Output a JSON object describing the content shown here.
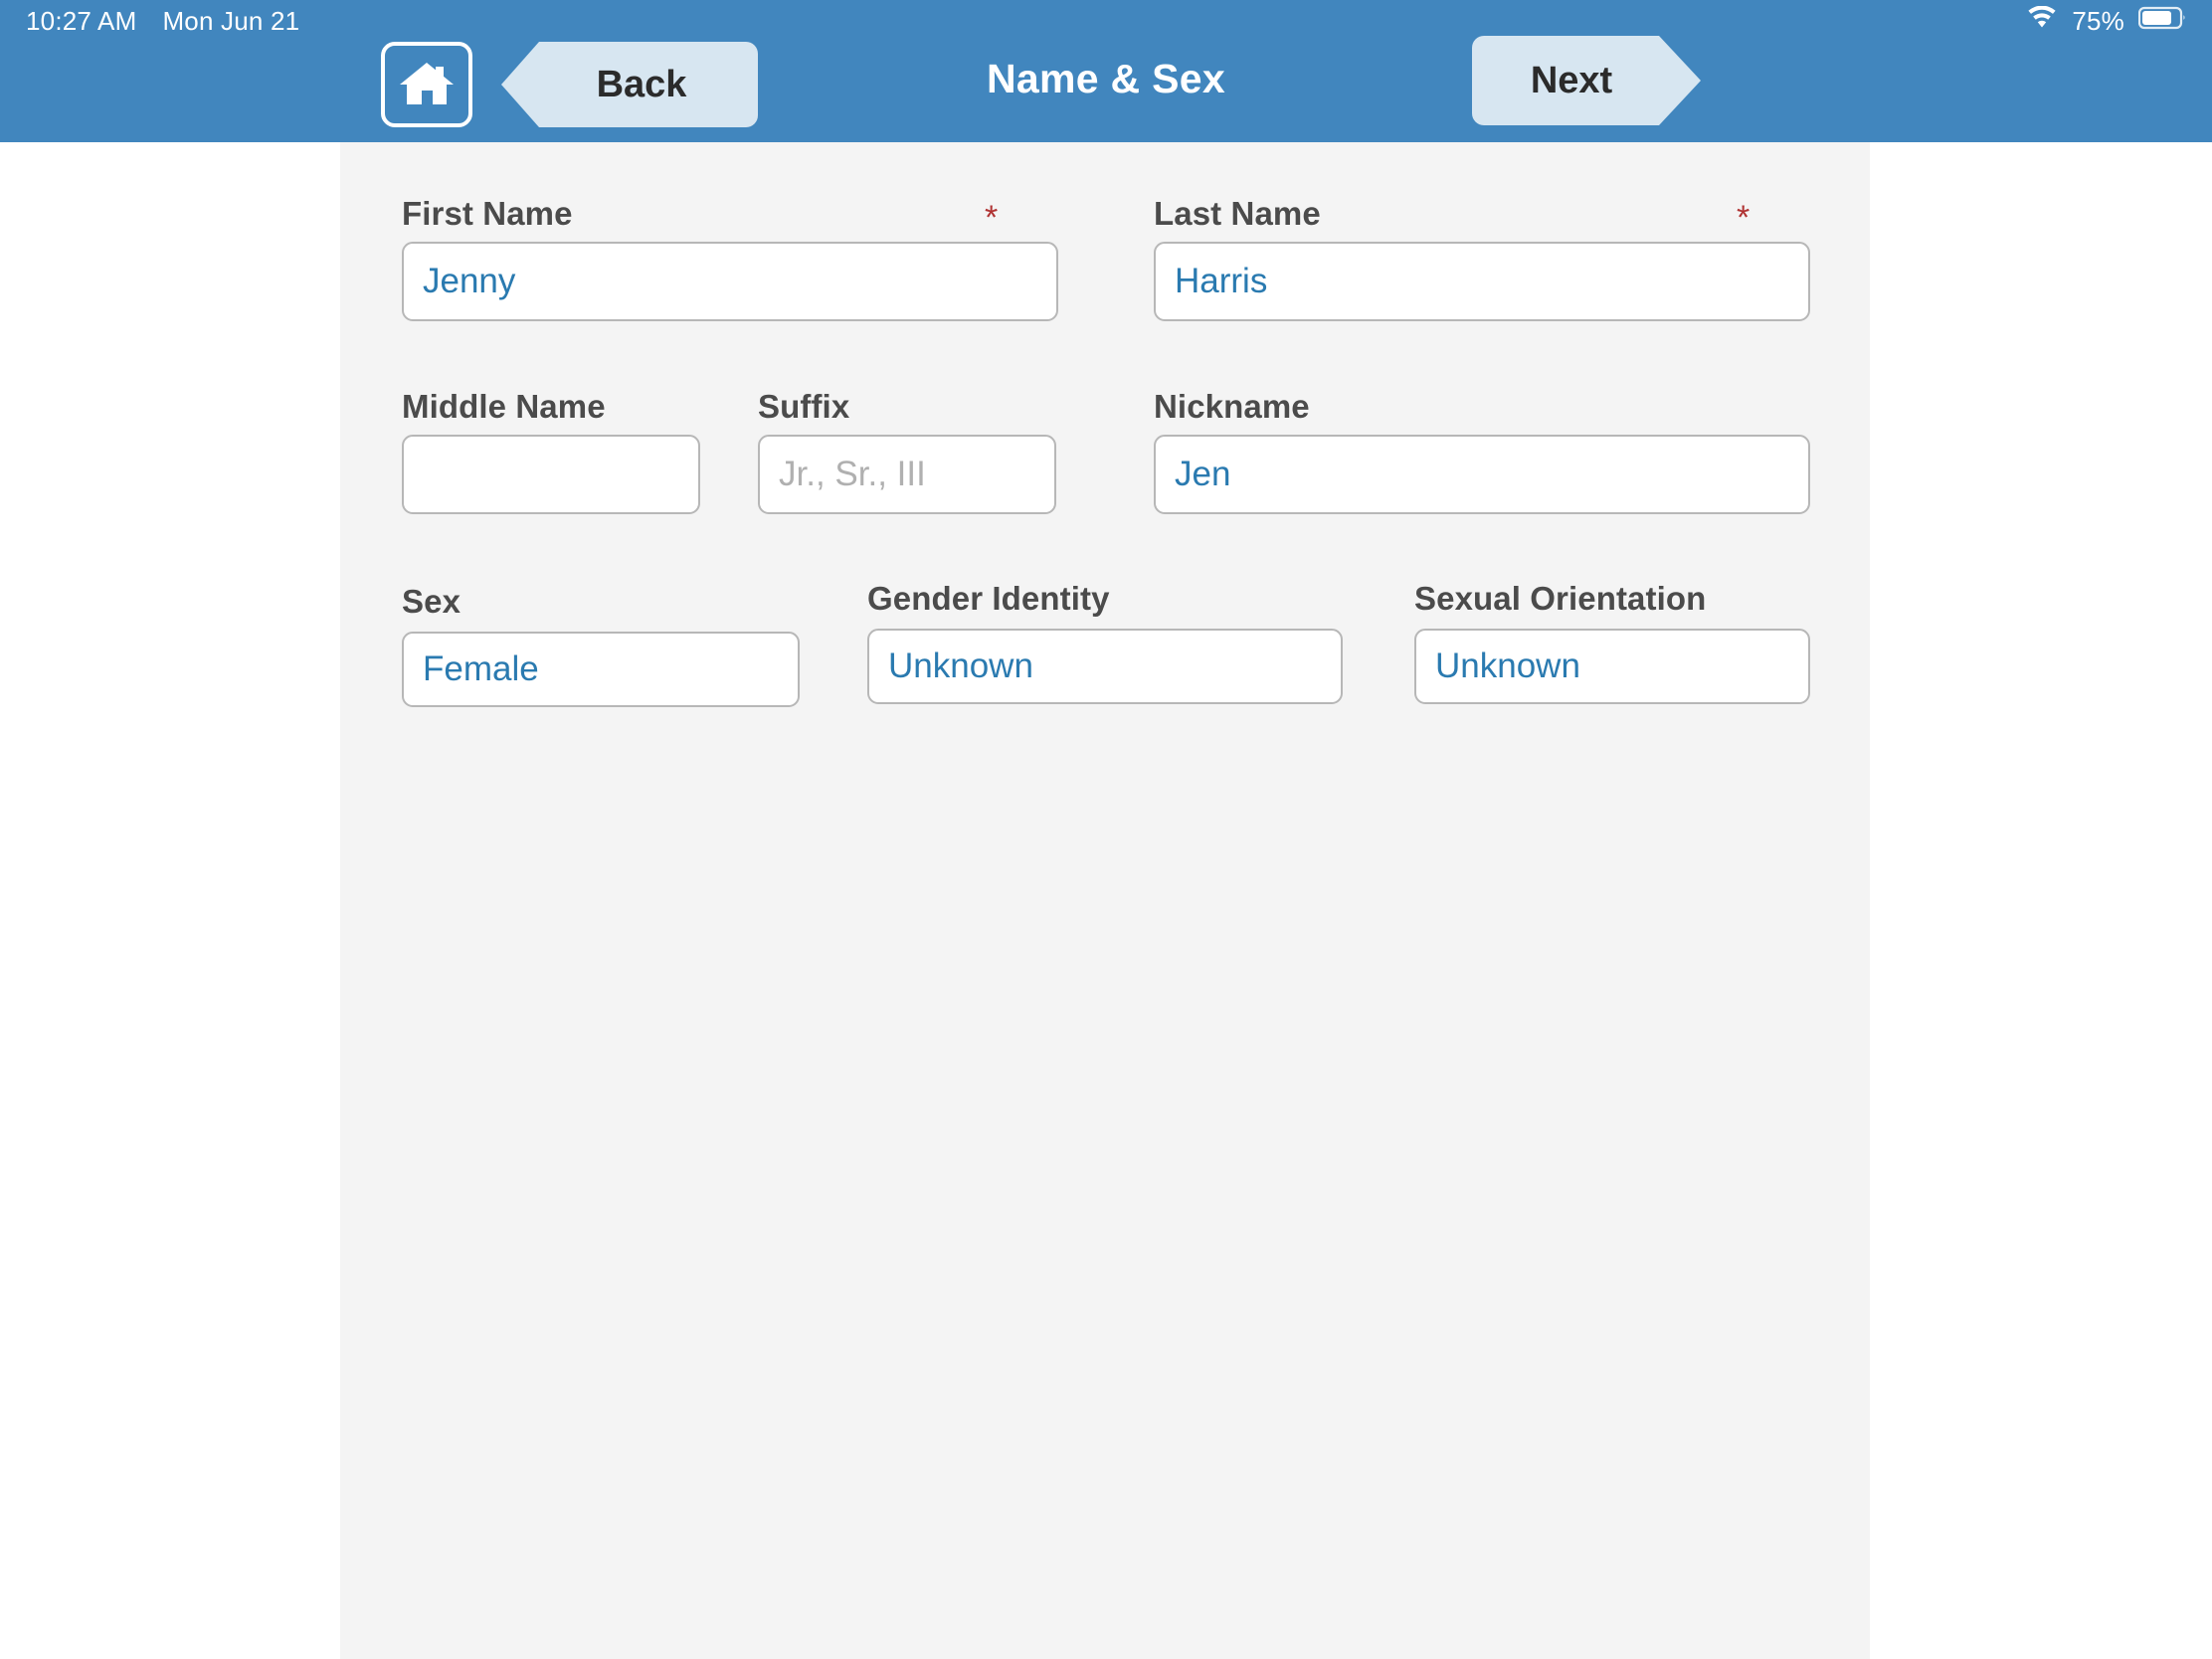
{
  "status_bar": {
    "time": "10:27 AM",
    "date": "Mon Jun 21",
    "wifi_icon": "wifi-icon",
    "battery_percent": "75%",
    "battery_icon": "battery-icon"
  },
  "nav_bar": {
    "home_icon": "home-icon",
    "back_label": "Back",
    "title": "Name & Sex",
    "next_label": "Next",
    "bar_color": "#4186be",
    "button_color": "#d7e6f1"
  },
  "form": {
    "required_marker": "*",
    "fields": [
      {
        "id": "first_name",
        "label": "First Name",
        "value": "Jenny",
        "placeholder": "",
        "required": true
      },
      {
        "id": "last_name",
        "label": "Last Name",
        "value": "Harris",
        "placeholder": "",
        "required": true
      },
      {
        "id": "middle_name",
        "label": "Middle Name",
        "value": "",
        "placeholder": "",
        "required": false
      },
      {
        "id": "suffix",
        "label": "Suffix",
        "value": "",
        "placeholder": "Jr., Sr., III",
        "required": false
      },
      {
        "id": "nickname",
        "label": "Nickname",
        "value": "Jen",
        "placeholder": "",
        "required": false
      },
      {
        "id": "sex",
        "label": "Sex",
        "value": "Female",
        "placeholder": "",
        "required": false
      },
      {
        "id": "gender_identity",
        "label": "Gender Identity",
        "value": "Unknown",
        "placeholder": "",
        "required": false
      },
      {
        "id": "sexual_orientation",
        "label": "Sexual Orientation",
        "value": "Unknown",
        "placeholder": "",
        "required": false
      }
    ]
  },
  "colors": {
    "accent_blue": "#4186be",
    "value_text": "#2a7ab0",
    "label_text": "#4b4b4b",
    "required_red": "#b03333",
    "panel_bg": "#f4f4f4",
    "placeholder_text": "#b0b0b0"
  }
}
